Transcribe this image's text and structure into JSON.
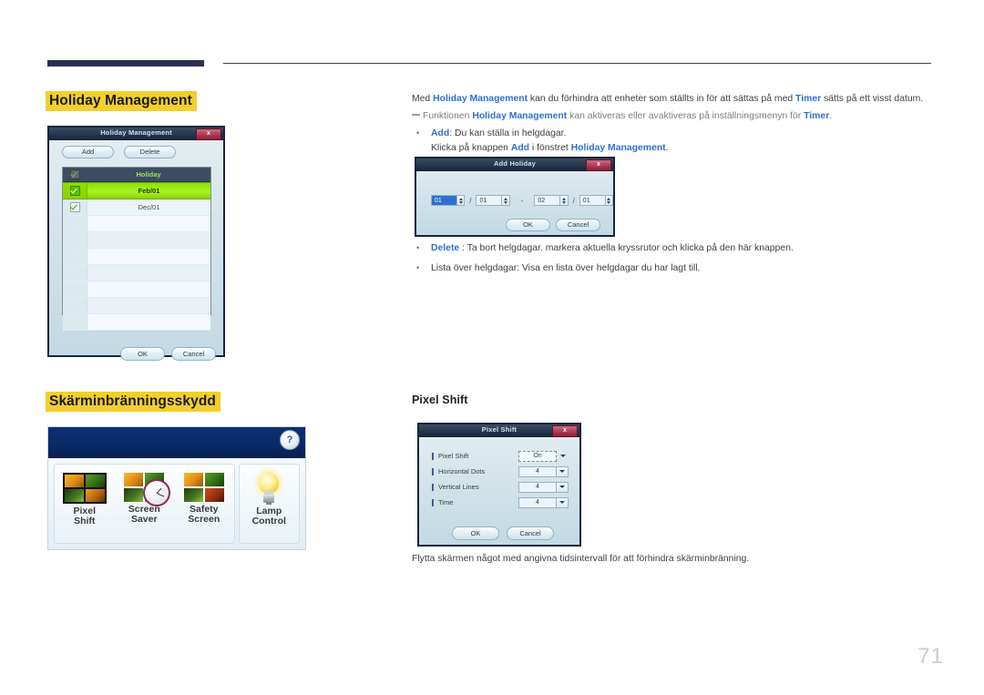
{
  "page": {
    "number": "71"
  },
  "headings": {
    "holiday_management": "Holiday Management",
    "screen_burn": "Skärminbränningsskydd",
    "pixel_shift": "Pixel Shift"
  },
  "body": {
    "intro_1": "Med ",
    "intro_b1": "Holiday Management",
    "intro_2": " kan du förhindra att enheter som ställts in för att sättas på med ",
    "intro_b2": "Timer",
    "intro_3": " sätts på ett visst datum.",
    "note_1": "Funktionen ",
    "note_b1": "Holiday Management",
    "note_2": " kan aktiveras eller avaktiveras på inställningsmenyn för ",
    "note_b2": "Timer",
    "note_3": ".",
    "bullet_add_b": "Add",
    "bullet_add_t": ": Du kan ställa in helgdagar.",
    "bullet_add_l1": "Klicka på knappen ",
    "bullet_add_l2": "Add",
    "bullet_add_l3": " i fönstret ",
    "bullet_add_l4": "Holiday Management",
    "bullet_add_l5": ".",
    "bullet_del_b": "Delete",
    "bullet_del_t": " : Ta bort helgdagar. markera aktuella kryssrutor och klicka på den här knappen.",
    "bullet_list_t": "Lista över helgdagar: Visa en lista över helgdagar du har lagt till.",
    "pixel_shift_caption": "Flytta skärmen något med angivna tidsintervall för att förhindra skärminbränning."
  },
  "dialog_holiday": {
    "title": "Holiday Management",
    "close": "x",
    "add": "Add",
    "delete": "Delete",
    "col_holiday": "Holiday",
    "rows": [
      {
        "date": "Feb/01",
        "checked": true,
        "selected": true
      },
      {
        "date": "Dec/01",
        "checked": true,
        "selected": false
      }
    ],
    "ok": "OK",
    "cancel": "Cancel"
  },
  "dialog_add_holiday": {
    "title": "Add Holiday",
    "close": "x",
    "start_month": "01",
    "start_day": "01",
    "separator": "-",
    "end_month": "02",
    "end_day": "01",
    "date_sep": "/",
    "ok": "OK",
    "cancel": "Cancel"
  },
  "dialog_pixel_shift": {
    "title": "Pixel Shift",
    "close": "x",
    "items": [
      {
        "label": "Pixel Shift",
        "value": "On"
      },
      {
        "label": "Horizontal Dots",
        "value": "4"
      },
      {
        "label": "Vertical Lines",
        "value": "4"
      },
      {
        "label": "Time",
        "value": "4"
      }
    ],
    "ok": "OK",
    "cancel": "Cancel"
  },
  "osd_panel": {
    "help": "?",
    "items": [
      {
        "line1": "Pixel",
        "line2": "Shift"
      },
      {
        "line1": "Screen",
        "line2": "Saver"
      },
      {
        "line1": "Safety",
        "line2": "Screen"
      },
      {
        "line1": "Lamp",
        "line2": "Control"
      }
    ]
  },
  "colors": {
    "heading_highlight": "#f2cf2b",
    "link_blue": "#2f6fd0",
    "rule_navy": "#2b3052",
    "selection_green": "#8ce000",
    "osd_blue": "#0b2f74"
  }
}
